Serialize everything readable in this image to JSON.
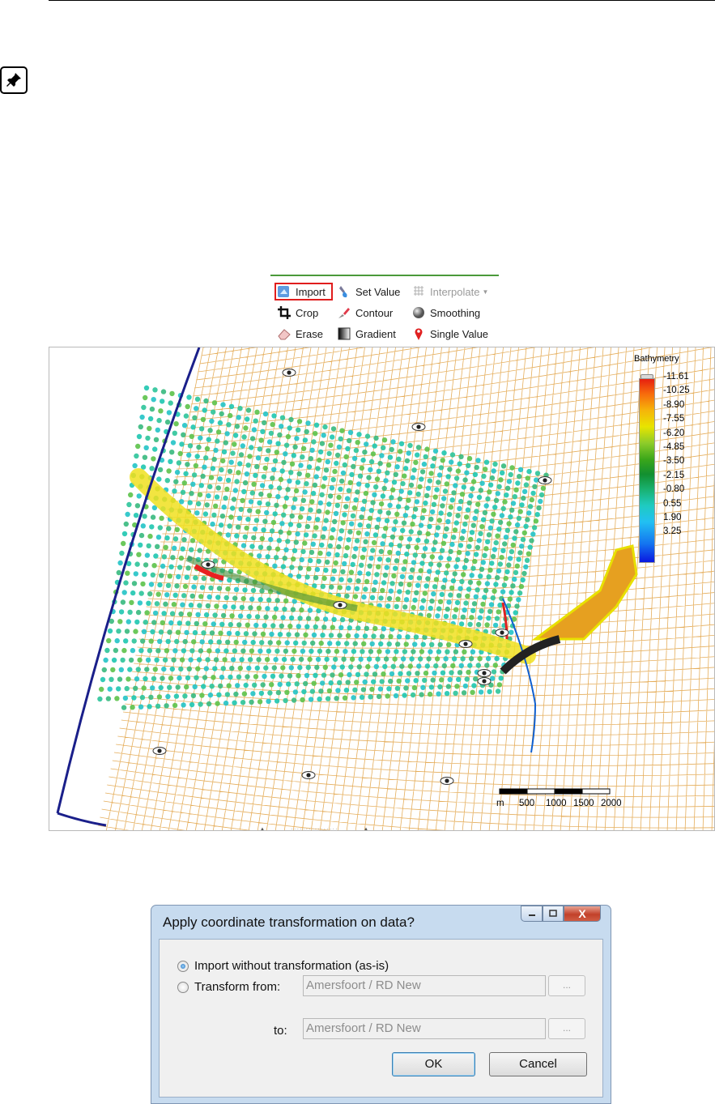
{
  "ribbon": {
    "items": [
      {
        "label": "Import",
        "icon": "import-icon"
      },
      {
        "label": "Set Value",
        "icon": "set-value-icon"
      },
      {
        "label": "Interpolate",
        "icon": "interpolate-icon",
        "disabled": true
      },
      {
        "label": "Crop",
        "icon": "crop-icon"
      },
      {
        "label": "Contour",
        "icon": "contour-icon"
      },
      {
        "label": "Smoothing",
        "icon": "smoothing-icon"
      },
      {
        "label": "Erase",
        "icon": "erase-icon"
      },
      {
        "label": "Gradient",
        "icon": "gradient-icon"
      },
      {
        "label": "Single Value",
        "icon": "single-value-icon"
      }
    ],
    "accent": "#4a9a3a",
    "highlight_color": "#e01d1d"
  },
  "map": {
    "legend_title": "Bathymetry",
    "legend_values": [
      "-11.61",
      "-10.25",
      "-8.90",
      "-7.55",
      "-6.20",
      "-4.85",
      "-3.50",
      "-2.15",
      "-0.80",
      "0.55",
      "1.90",
      "3.25"
    ],
    "scale_labels": [
      "m",
      "500",
      "1000",
      "1500",
      "2000"
    ],
    "grid_color": "#e0a040"
  },
  "dialog": {
    "title": "Apply coordinate transformation on data?",
    "option_as_is": "Import without transformation (as-is)",
    "option_transform": "Transform from:",
    "from_value": "Amersfoort / RD New",
    "to_label": "to:",
    "to_value": "Amersfoort / RD New",
    "browse_label": "...",
    "ok_label": "OK",
    "cancel_label": "Cancel",
    "close_glyph": "X"
  }
}
